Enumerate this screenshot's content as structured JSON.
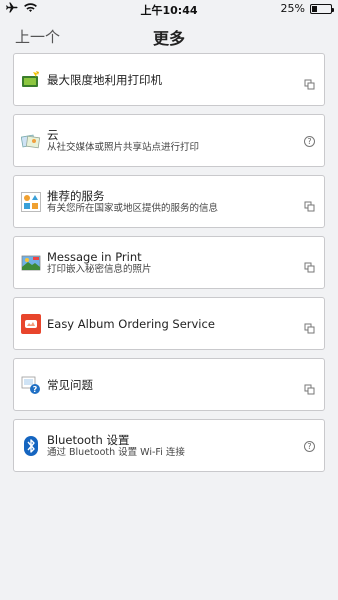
{
  "status_bar": {
    "time": "上午10:44",
    "battery": "25%",
    "battery_level": 0.25
  },
  "nav": {
    "back_label": "上一个",
    "title": "更多"
  },
  "items": [
    {
      "title": "最大限度地利用打印机",
      "subtitle": "",
      "icon": "printer-photo-icon",
      "trail": "external-link-icon"
    },
    {
      "title": "云",
      "subtitle": "从社交媒体或照片共享站点进行打印",
      "icon": "cloud-photos-icon",
      "trail": "help-icon"
    },
    {
      "title": "推荐的服务",
      "subtitle": "有关您所在国家或地区提供的服务的信息",
      "icon": "shapes-icon",
      "trail": "external-link-icon"
    },
    {
      "title": "Message in Print",
      "subtitle": "打印嵌入秘密信息的照片",
      "icon": "message-photo-icon",
      "trail": "external-link-icon"
    },
    {
      "title": "Easy Album Ordering Service",
      "subtitle": "",
      "icon": "album-icon",
      "trail": "external-link-icon"
    },
    {
      "title": "常见问题",
      "subtitle": "",
      "icon": "faq-icon",
      "trail": "external-link-icon"
    },
    {
      "title": "Bluetooth 设置",
      "subtitle": "通过 Bluetooth 设置 Wi-Fi 连接",
      "icon": "bluetooth-icon",
      "trail": "help-icon"
    }
  ]
}
